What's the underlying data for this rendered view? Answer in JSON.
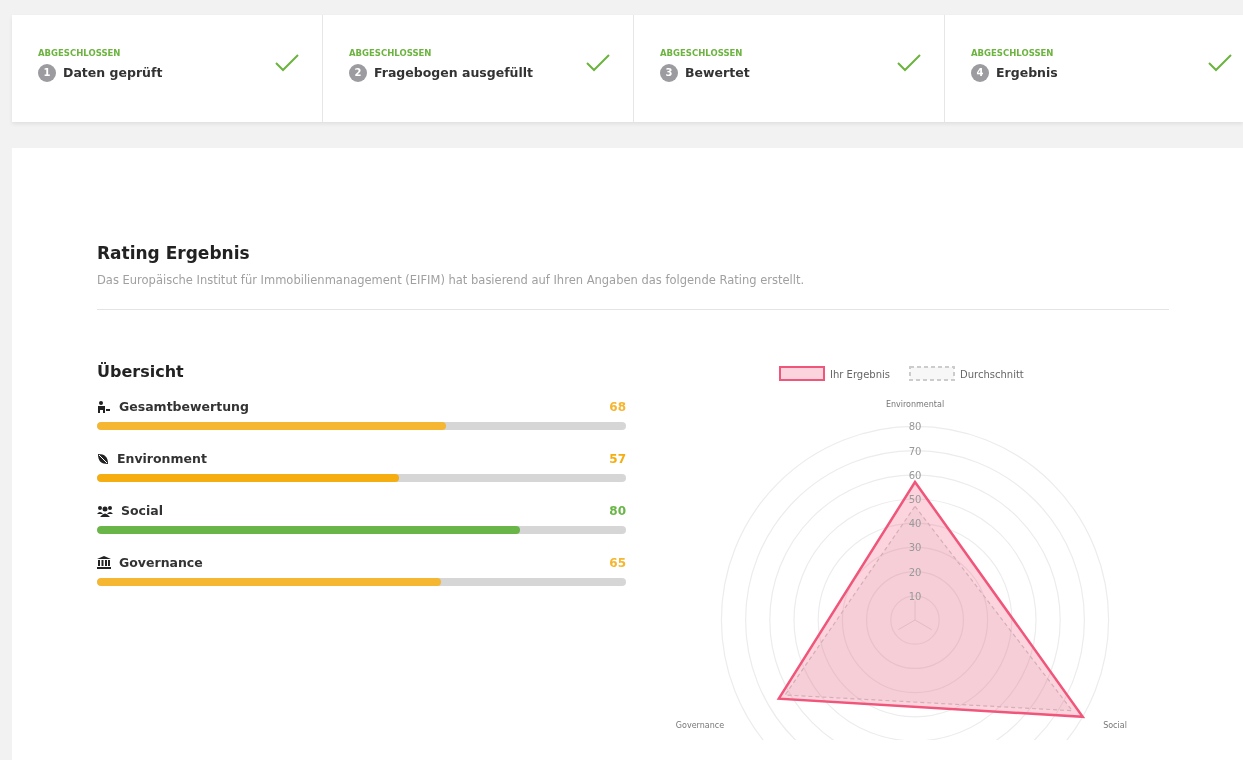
{
  "steps": [
    {
      "status": "ABGESCHLOSSEN",
      "number": "1",
      "label": "Daten geprüft",
      "done": true
    },
    {
      "status": "ABGESCHLOSSEN",
      "number": "2",
      "label": "Fragebogen ausgefüllt",
      "done": true
    },
    {
      "status": "ABGESCHLOSSEN",
      "number": "3",
      "label": "Bewertet",
      "done": true
    },
    {
      "status": "ABGESCHLOSSEN",
      "number": "4",
      "label": "Ergebnis",
      "done": true
    }
  ],
  "result": {
    "title": "Rating Ergebnis",
    "description": "Das Europäische Institut für Immobilienmanagement (EIFIM) hat basierend auf Ihren Angaben das folgende Rating erstellt."
  },
  "overview": {
    "title": "Übersicht",
    "metrics": [
      {
        "kind": "overall",
        "label": "Gesamtbewertung",
        "value": "68",
        "level": 0.66,
        "color": "#f5b631"
      },
      {
        "kind": "environment",
        "label": "Environment",
        "value": "57",
        "level": 0.57,
        "color": "#f5ad0f"
      },
      {
        "kind": "social",
        "label": "Social",
        "value": "80",
        "level": 0.8,
        "color": "#6ab547"
      },
      {
        "kind": "governance",
        "label": "Governance",
        "value": "65",
        "level": 0.65,
        "color": "#f5b631"
      }
    ]
  },
  "chart": {
    "legend": [
      "Ihr Ergebnis",
      "Durchschnitt"
    ],
    "axis_labels": [
      "Environmental",
      "Social",
      "Governance"
    ],
    "scale_labels": [
      "80",
      "70",
      "60",
      "50",
      "40",
      "30",
      "20",
      "10"
    ]
  }
}
